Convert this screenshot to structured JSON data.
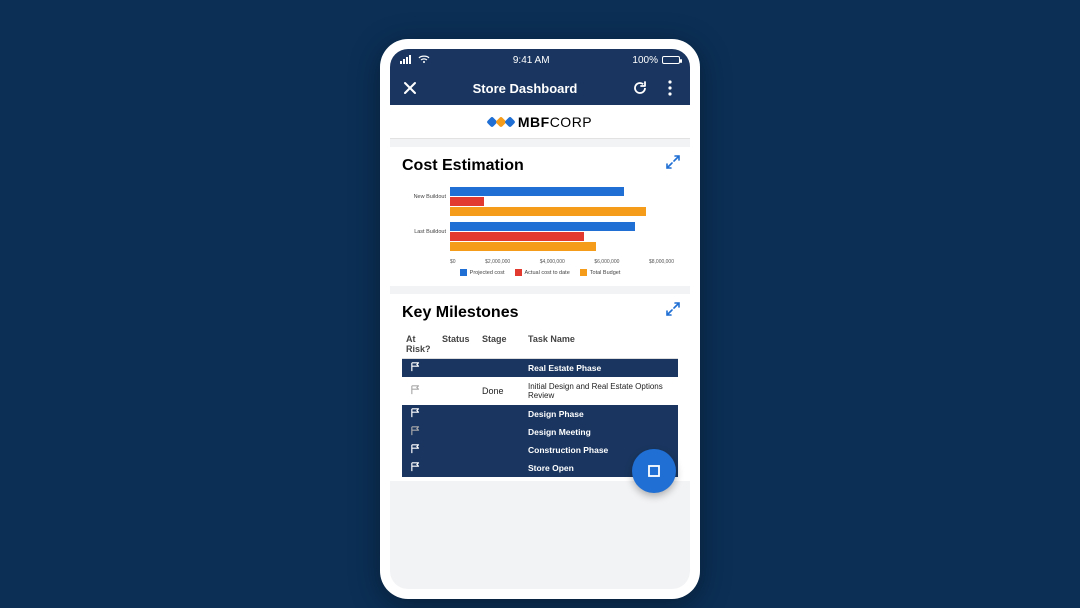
{
  "status_bar": {
    "time": "9:41 AM",
    "battery_pct": "100%"
  },
  "nav": {
    "title": "Store Dashboard"
  },
  "brand": {
    "name_bold": "MBF",
    "name_light": "CORP"
  },
  "cost_card": {
    "title": "Cost Estimation"
  },
  "milestones_card": {
    "title": "Key Milestones"
  },
  "table": {
    "headers": {
      "risk": "At Risk?",
      "status": "Status",
      "stage": "Stage",
      "task": "Task Name"
    },
    "rows": [
      {
        "type": "dark",
        "flag": "white",
        "status": "green",
        "stage": "",
        "task": "Real Estate Phase"
      },
      {
        "type": "light",
        "flag": "grey",
        "status": "green",
        "stage": "Done",
        "task": "Initial Design and Real Estate Options Review"
      },
      {
        "type": "dark",
        "flag": "white",
        "status": "green",
        "stage": "",
        "task": "Design Phase"
      },
      {
        "type": "dark",
        "flag": "grey",
        "status": "green",
        "stage": "",
        "task": "Design Meeting"
      },
      {
        "type": "dark",
        "flag": "white",
        "status": "green",
        "stage": "",
        "task": "Construction Phase"
      },
      {
        "type": "dark",
        "flag": "white",
        "status": "green",
        "stage": "",
        "task": "Store Open"
      }
    ]
  },
  "chart_data": {
    "type": "bar",
    "orientation": "horizontal",
    "title": "Cost Estimation",
    "xlabel": "",
    "ylabel": "",
    "xlim": [
      0,
      8000000
    ],
    "x_ticks": [
      "$0",
      "$2,000,000",
      "$4,000,000",
      "$6,000,000",
      "$8,000,000"
    ],
    "categories": [
      "New Buildout",
      "Last Buildout"
    ],
    "series": [
      {
        "name": "Projected cost",
        "color": "#1f6fd4",
        "values": [
          6200000,
          6600000
        ]
      },
      {
        "name": "Actual cost to date",
        "color": "#e23a2e",
        "values": [
          1200000,
          4800000
        ]
      },
      {
        "name": "Total Budget",
        "color": "#f59c1a",
        "values": [
          7000000,
          5200000
        ]
      }
    ]
  }
}
